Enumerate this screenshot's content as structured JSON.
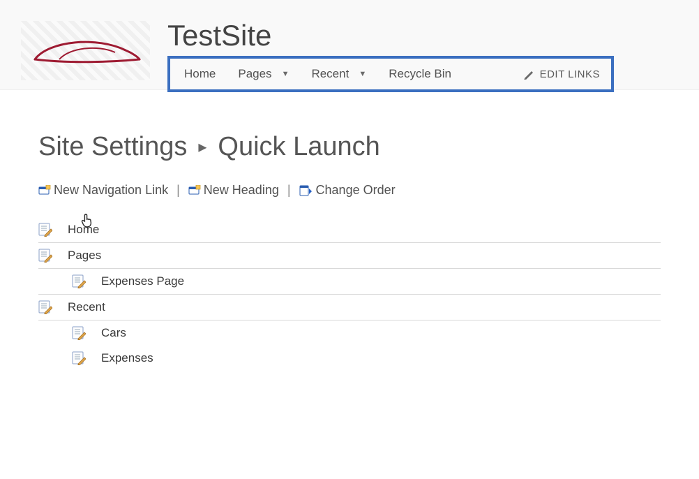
{
  "site": {
    "title": "TestSite"
  },
  "topNav": {
    "items": [
      {
        "label": "Home",
        "hasDropdown": false
      },
      {
        "label": "Pages",
        "hasDropdown": true
      },
      {
        "label": "Recent",
        "hasDropdown": true
      },
      {
        "label": "Recycle Bin",
        "hasDropdown": false
      }
    ],
    "editLinksLabel": "EDIT LINKS"
  },
  "breadcrumb": {
    "parent": "Site Settings",
    "current": "Quick Launch"
  },
  "toolbar": {
    "newLink": "New Navigation Link",
    "newHeading": "New Heading",
    "changeOrder": "Change Order"
  },
  "tree": {
    "home": {
      "label": "Home"
    },
    "pages": {
      "label": "Pages"
    },
    "expPage": {
      "label": "Expenses Page"
    },
    "recent": {
      "label": "Recent"
    },
    "cars": {
      "label": "Cars"
    },
    "expenses": {
      "label": "Expenses"
    }
  }
}
